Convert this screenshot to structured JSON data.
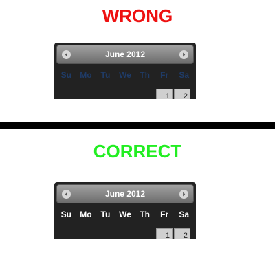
{
  "wrong": {
    "heading": "WRONG",
    "heading_color": "#ee1111",
    "month_label": "June 2012",
    "weekdays": [
      "Su",
      "Mo",
      "Tu",
      "We",
      "Th",
      "Fr",
      "Sa"
    ],
    "weekday_color": "#1f3b66",
    "days": [
      "1",
      "2"
    ],
    "nav_prev_icon": "chevron-left-icon",
    "nav_next_icon": "chevron-right-icon"
  },
  "correct": {
    "heading": "CORRECT",
    "heading_color": "#22ee22",
    "month_label": "June 2012",
    "weekdays": [
      "Su",
      "Mo",
      "Tu",
      "We",
      "Th",
      "Fr",
      "Sa"
    ],
    "weekday_color": "#ffffff",
    "days": [
      "1",
      "2"
    ],
    "nav_prev_icon": "chevron-left-icon",
    "nav_next_icon": "chevron-right-icon"
  },
  "colors": {
    "calendar_bg": "#222222",
    "divider": "#000000"
  }
}
